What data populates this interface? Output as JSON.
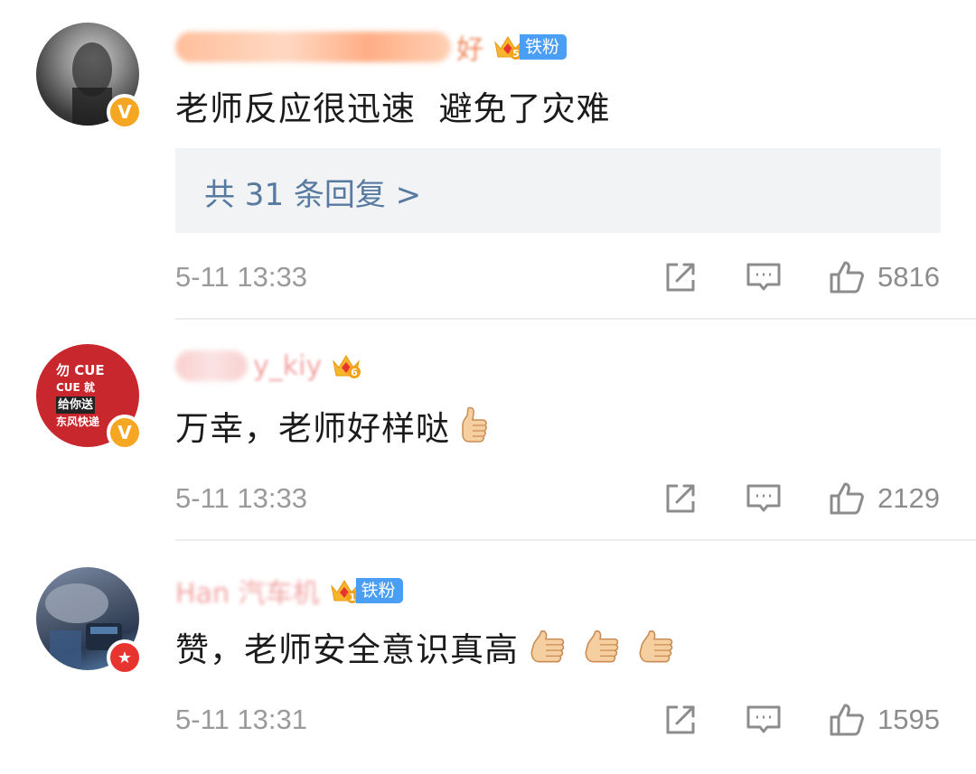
{
  "comments": [
    {
      "badge_type": "verified-gold",
      "badge_text": "V",
      "name_visible_fragment": "好",
      "level": "5",
      "fan_label": "铁粉",
      "text": "老师反应很迅速  避免了灾难",
      "replies_label": "共 31 条回复 >",
      "time": "5-11 13:33",
      "likes": "5816"
    },
    {
      "badge_type": "verified-gold",
      "badge_text": "V",
      "name_visible_fragment": "y_kiy",
      "level": "6",
      "text": "万幸，老师好样哒",
      "avatar_lines": [
        "勿 CUE",
        "CUE 就",
        "给你送",
        "东风快递"
      ],
      "time": "5-11 13:33",
      "likes": "2129"
    },
    {
      "badge_type": "red-star",
      "badge_text": "★",
      "name_visible_fragment": "Han 汽车机",
      "level": "1",
      "fan_label": "铁粉",
      "text": "赞，老师安全意识真高",
      "time": "5-11 13:31",
      "likes": "1595"
    }
  ],
  "icons": {
    "share": "share-icon",
    "reply": "comment-icon",
    "like": "thumbs-up-icon",
    "emoji": "thumbs-up-emoji"
  },
  "colors": {
    "link_blue": "#587aa0",
    "meta_gray": "#9a9a9a",
    "fan_badge": "#4a9ff5",
    "verified_gold": "#f5a623",
    "verified_red": "#e8342e"
  }
}
